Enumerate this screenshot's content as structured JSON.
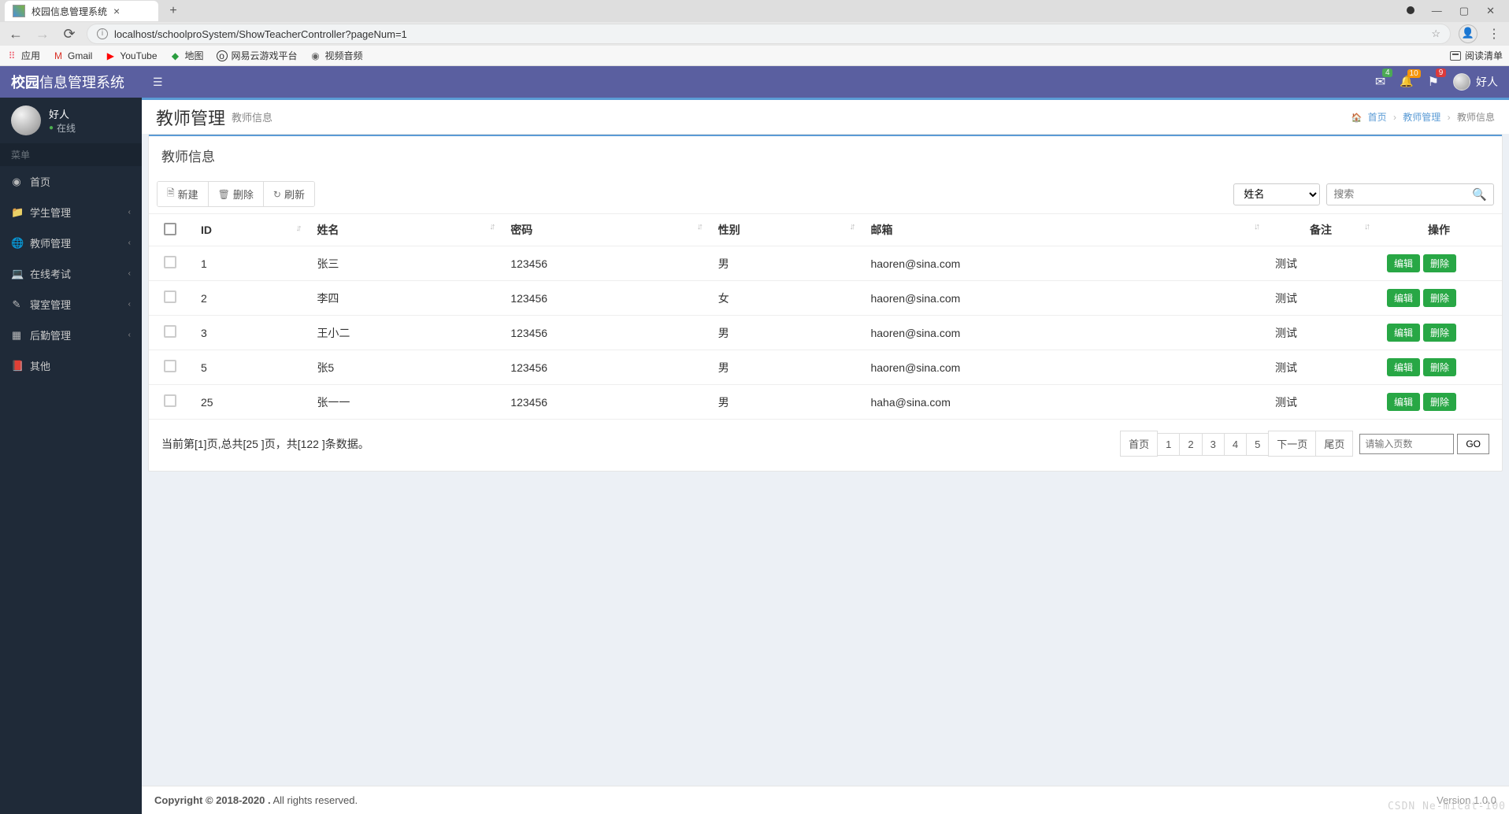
{
  "browser": {
    "tab_title": "校园信息管理系统",
    "url": "localhost/schoolproSystem/ShowTeacherController?pageNum=1",
    "bookmark_apps": "应用",
    "bookmark_gmail": "Gmail",
    "bookmark_youtube": "YouTube",
    "bookmark_map": "地图",
    "bookmark_netease": "网易云游戏平台",
    "bookmark_media": "视频音频",
    "reading_list": "阅读清单"
  },
  "topbar": {
    "brand_bold": "校园",
    "brand_rest": "信息管理系统",
    "notif_mail_count": "4",
    "notif_bell_count": "10",
    "notif_flag_count": "9",
    "username": "好人"
  },
  "sidebar": {
    "username": "好人",
    "status": "在线",
    "menu_label": "菜单",
    "items": [
      {
        "icon": "dashboard",
        "label": "首页",
        "expandable": false
      },
      {
        "icon": "folder",
        "label": "学生管理",
        "expandable": true
      },
      {
        "icon": "globe",
        "label": "教师管理",
        "expandable": true
      },
      {
        "icon": "laptop",
        "label": "在线考试",
        "expandable": true
      },
      {
        "icon": "edit",
        "label": "寝室管理",
        "expandable": true
      },
      {
        "icon": "grid",
        "label": "后勤管理",
        "expandable": true
      },
      {
        "icon": "book",
        "label": "其他",
        "expandable": false
      }
    ]
  },
  "page": {
    "title": "教师管理",
    "subtitle": "教师信息",
    "crumb_home": "首页",
    "crumb_mid": "教师管理",
    "crumb_last": "教师信息"
  },
  "panel": {
    "title": "教师信息",
    "btn_new": "新建",
    "btn_del": "删除",
    "btn_refresh": "刷新",
    "search_by_label": "姓名",
    "search_placeholder": "搜索"
  },
  "table": {
    "headers": {
      "id": "ID",
      "name": "姓名",
      "pwd": "密码",
      "gender": "性别",
      "email": "邮箱",
      "remark": "备注",
      "op": "操作"
    },
    "btn_edit": "编辑",
    "btn_delete": "删除",
    "rows": [
      {
        "id": "1",
        "name": "张三",
        "pwd": "123456",
        "gender": "男",
        "email": "haoren@sina.com",
        "remark": "测试"
      },
      {
        "id": "2",
        "name": "李四",
        "pwd": "123456",
        "gender": "女",
        "email": "haoren@sina.com",
        "remark": "测试"
      },
      {
        "id": "3",
        "name": "王小二",
        "pwd": "123456",
        "gender": "男",
        "email": "haoren@sina.com",
        "remark": "测试"
      },
      {
        "id": "5",
        "name": "张5",
        "pwd": "123456",
        "gender": "男",
        "email": "haoren@sina.com",
        "remark": "测试"
      },
      {
        "id": "25",
        "name": "张一一",
        "pwd": "123456",
        "gender": "男",
        "email": "haha@sina.com",
        "remark": "测试"
      }
    ]
  },
  "pager": {
    "info": "当前第[1]页,总共[25 ]页，共[122 ]条数据。",
    "first": "首页",
    "pages": [
      "1",
      "2",
      "3",
      "4",
      "5"
    ],
    "next": "下一页",
    "last": "尾页",
    "goto_placeholder": "请输入页数",
    "go_label": "GO"
  },
  "footer": {
    "copyright_bold": "Copyright © 2018-2020 .",
    "copyright_rest": " All rights reserved.",
    "version": "Version 1.0.0",
    "watermark": "CSDN Ne-micat-100"
  }
}
